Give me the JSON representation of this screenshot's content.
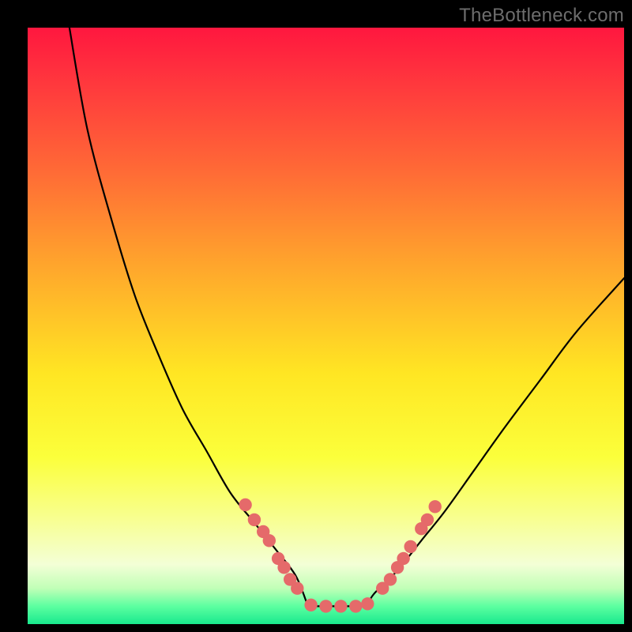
{
  "watermark": "TheBottleneck.com",
  "colors": {
    "frame": "#000000",
    "curve": "#000000",
    "dot_fill": "#e56a6a",
    "gradient_top": "#ff173f",
    "gradient_bottom": "#18e98e"
  },
  "chart_data": {
    "type": "line",
    "title": "",
    "xlabel": "",
    "ylabel": "",
    "xlim": [
      0,
      100
    ],
    "ylim": [
      0,
      100
    ],
    "note": "V-shaped bottleneck curve overlaid on vertical heat gradient. Axis values are not labeled in the source image; data below is estimated from pixel positions on a 0–100 normalized grid (x left→right, y = distance from the top; higher y = closer to the green/bottom/optimal zone).",
    "series": [
      {
        "name": "bottleneck-curve",
        "x": [
          7,
          10,
          14,
          18,
          22,
          26,
          30,
          34,
          38,
          42,
          45,
          48,
          51,
          54,
          58,
          62,
          66,
          70,
          75,
          80,
          86,
          92,
          100
        ],
        "y": [
          0,
          17,
          32,
          45,
          55,
          64,
          71,
          78,
          83,
          88,
          92,
          95,
          97,
          97,
          95,
          91,
          86,
          81,
          74,
          67,
          59,
          51,
          42
        ]
      }
    ],
    "flat_bottom": {
      "x_start": 47,
      "x_end": 57,
      "y": 97
    },
    "markers": {
      "name": "sample-dots",
      "note": "Salmon dots along the lower portion of both arms and the trough.",
      "points": [
        {
          "x": 36.5,
          "y": 80
        },
        {
          "x": 38,
          "y": 82.5
        },
        {
          "x": 39.5,
          "y": 84.5
        },
        {
          "x": 40.5,
          "y": 86
        },
        {
          "x": 42,
          "y": 89
        },
        {
          "x": 43,
          "y": 90.5
        },
        {
          "x": 44,
          "y": 92.5
        },
        {
          "x": 45.2,
          "y": 94
        },
        {
          "x": 47.5,
          "y": 96.8
        },
        {
          "x": 50,
          "y": 97
        },
        {
          "x": 52.5,
          "y": 97
        },
        {
          "x": 55,
          "y": 97
        },
        {
          "x": 57,
          "y": 96.6
        },
        {
          "x": 59.5,
          "y": 94
        },
        {
          "x": 60.8,
          "y": 92.5
        },
        {
          "x": 62,
          "y": 90.5
        },
        {
          "x": 63,
          "y": 89
        },
        {
          "x": 64.2,
          "y": 87
        },
        {
          "x": 66,
          "y": 84
        },
        {
          "x": 67,
          "y": 82.5
        },
        {
          "x": 68.3,
          "y": 80.3
        }
      ]
    }
  }
}
